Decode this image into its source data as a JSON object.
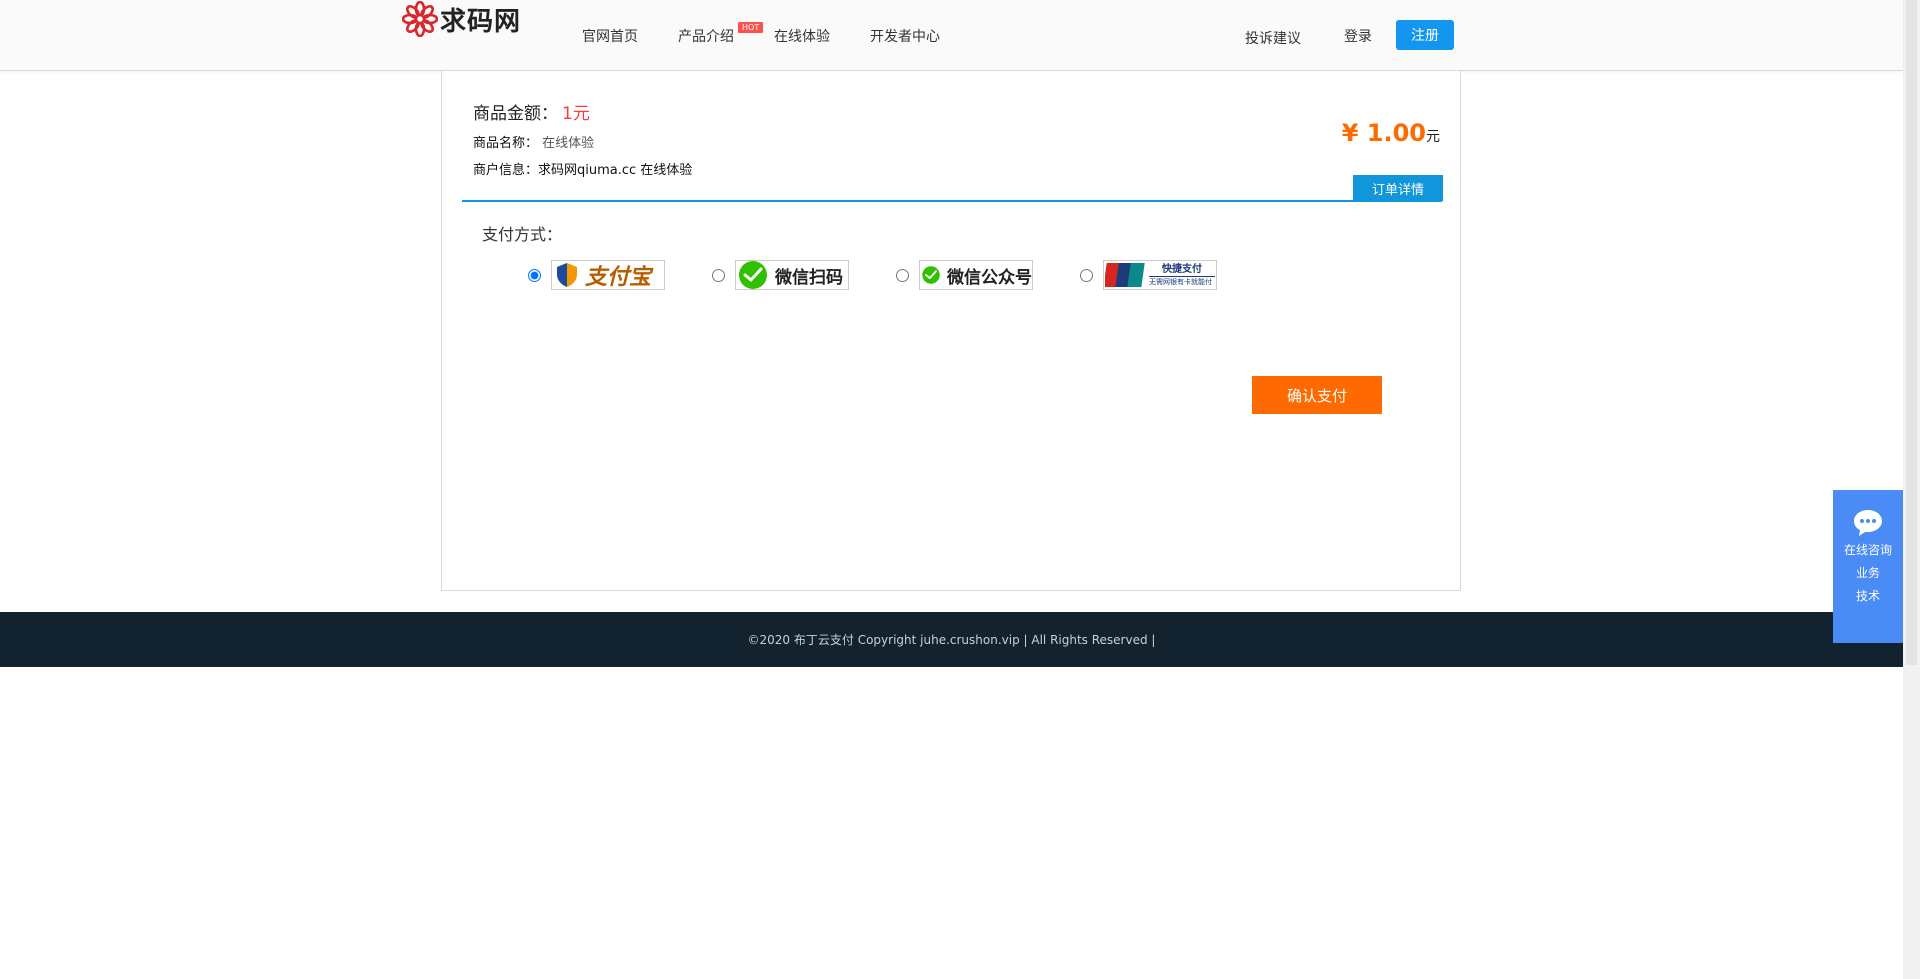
{
  "header": {
    "logo_text": "求码网",
    "nav": [
      "官网首页",
      "产品介绍",
      "在线体验",
      "开发者中心"
    ],
    "hot_badge": "HOT",
    "complaint": "投诉建议",
    "login": "登录",
    "register": "注册"
  },
  "order": {
    "amount_label": "商品金额：",
    "amount_value": "1元",
    "name_label": "商品名称：",
    "name_value": "在线体验",
    "merchant_label": "商户信息：",
    "merchant_value": "求码网qiuma.cc 在线体验",
    "price": "¥ 1.00",
    "price_unit": "元",
    "detail_button": "订单详情"
  },
  "payment": {
    "label": "支付方式：",
    "options": [
      {
        "name": "支付宝",
        "icon": "alipay-icon",
        "selected": true
      },
      {
        "name": "微信扫码",
        "icon": "wechat-icon",
        "selected": false
      },
      {
        "name": "微信公众号",
        "icon": "wechat-icon",
        "selected": false
      },
      {
        "name": "快捷支付",
        "sub": "无需网银有卡就能付",
        "icon": "unionpay-icon",
        "badge": "UnionPay 银联",
        "selected": false
      }
    ],
    "confirm": "确认支付"
  },
  "footer": {
    "copyright": "©2020 布丁云支付 Copyright juhe.crushon.vip | All Rights Reserved |"
  },
  "side": {
    "items": [
      "在线咨询",
      "业务",
      "技术"
    ]
  },
  "colors": {
    "accent": "#1296db",
    "price": "#ff6a00",
    "confirm": "#ff6a00",
    "footer_bg": "#12232f",
    "side_bg": "#4b8bf5"
  }
}
